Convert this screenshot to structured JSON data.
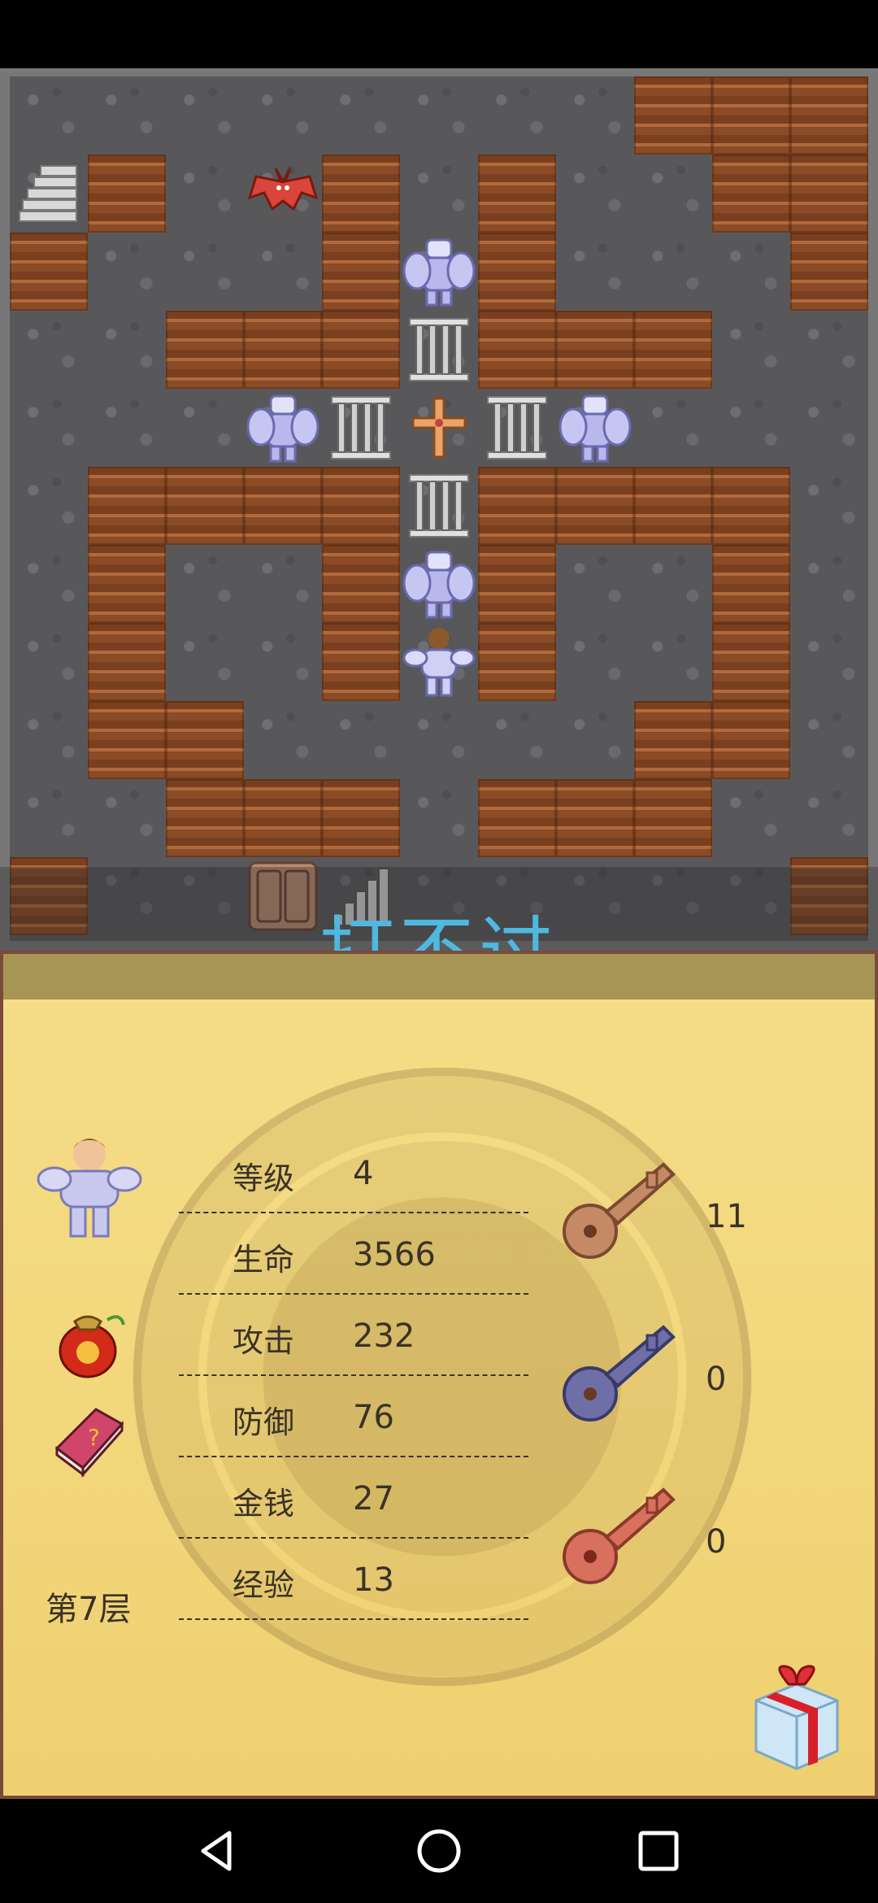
{
  "banner": {
    "text": "打不过"
  },
  "stats": [
    {
      "label": "等级",
      "value": "4"
    },
    {
      "label": "生命",
      "value": "3566"
    },
    {
      "label": "攻击",
      "value": "232"
    },
    {
      "label": "防御",
      "value": "76"
    },
    {
      "label": "金钱",
      "value": "27"
    },
    {
      "label": "经验",
      "value": "13"
    }
  ],
  "keys": [
    {
      "name": "yellow-key",
      "count": "11",
      "color": "#c48a66"
    },
    {
      "name": "blue-key",
      "count": "0",
      "color": "#6f6fa8"
    },
    {
      "name": "red-key",
      "count": "0",
      "color": "#d9705e"
    }
  ],
  "floor": {
    "label": "第7层"
  },
  "colors": {
    "banner_text": "#4fb8e0",
    "panel_bg": "#f2d67a",
    "wall": "#9b5a30",
    "floor": "#58585b"
  },
  "navbar": {
    "back": "back-icon",
    "home": "home-icon",
    "recents": "recents-icon"
  }
}
